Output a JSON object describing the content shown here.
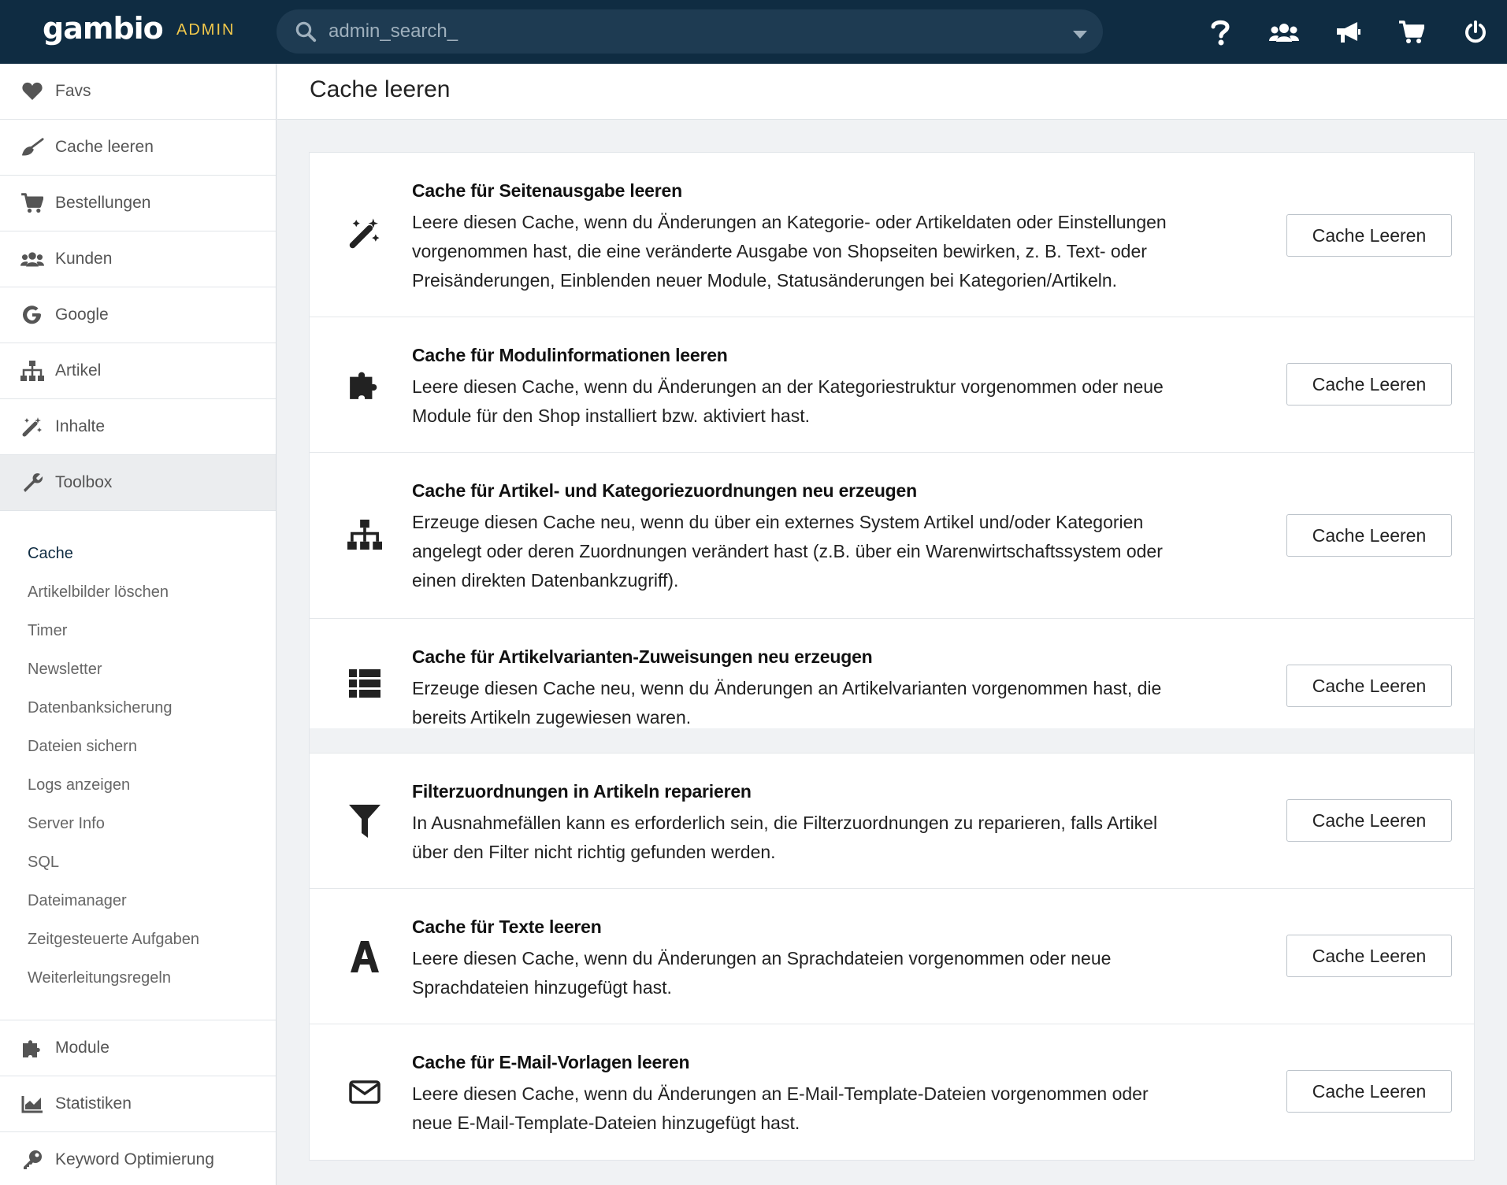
{
  "topbar": {
    "logo": "gambio",
    "admin_label": "ADMIN",
    "search_placeholder": "admin_search_",
    "icons": [
      "help-icon",
      "users-icon",
      "megaphone-icon",
      "cart-icon",
      "power-icon"
    ]
  },
  "sidebar": {
    "items": [
      {
        "label": "Favs",
        "icon": "heart-icon"
      },
      {
        "label": "Cache leeren",
        "icon": "broom-icon"
      },
      {
        "label": "Bestellungen",
        "icon": "cart-icon"
      },
      {
        "label": "Kunden",
        "icon": "users-icon"
      },
      {
        "label": "Google",
        "icon": "google-icon"
      },
      {
        "label": "Artikel",
        "icon": "sitemap-icon"
      },
      {
        "label": "Inhalte",
        "icon": "magic-wand-icon"
      },
      {
        "label": "Toolbox",
        "icon": "wrench-icon"
      }
    ],
    "toolbox_sub": [
      "Cache",
      "Artikelbilder löschen",
      "Timer",
      "Newsletter",
      "Datenbanksicherung",
      "Dateien sichern",
      "Logs anzeigen",
      "Server Info",
      "SQL",
      "Dateimanager",
      "Zeitgesteuerte Aufgaben",
      "Weiterleitungsregeln"
    ],
    "bottom_items": [
      {
        "label": "Module",
        "icon": "puzzle-icon"
      },
      {
        "label": "Statistiken",
        "icon": "chart-icon"
      },
      {
        "label": "Keyword Optimierung",
        "icon": "key-icon"
      }
    ]
  },
  "main": {
    "title": "Cache leeren",
    "cards": [
      {
        "icon": "magic-wand-icon",
        "title": "Cache für Seitenausgabe leeren",
        "lines": [
          "Leere diesen Cache, wenn du Änderungen an Kategorie- oder Artikeldaten oder Einstellungen",
          "vorgenommen hast, die eine veränderte Ausgabe von Shopseiten bewirken, z. B. Text- oder",
          "Preisänderungen, Einblenden neuer Module, Statusänderungen bei Kategorien/Artikeln."
        ],
        "button": "Cache Leeren"
      },
      {
        "icon": "puzzle-icon",
        "title": "Cache für Modulinformationen leeren",
        "lines": [
          "Leere diesen Cache, wenn du Änderungen an der Kategoriestruktur vorgenommen oder neue",
          "Module für den Shop installiert bzw. aktiviert hast."
        ],
        "button": "Cache Leeren"
      },
      {
        "icon": "sitemap-icon",
        "title": "Cache für Artikel- und Kategoriezuordnungen neu erzeugen",
        "lines": [
          "Erzeuge diesen Cache neu, wenn du über ein externes System Artikel und/oder Kategorien",
          "angelegt oder deren Zuordnungen verändert hast (z.B. über ein Warenwirtschaftssystem oder",
          "einen direkten Datenbankzugriff)."
        ],
        "button": "Cache Leeren"
      },
      {
        "icon": "list-icon",
        "title": "Cache für Artikelvarianten-Zuweisungen neu erzeugen",
        "lines": [
          "Erzeuge diesen Cache neu, wenn du Änderungen an Artikelvarianten vorgenommen hast, die",
          "bereits Artikeln zugewiesen waren."
        ],
        "button": "Cache Leeren"
      },
      {
        "icon": "filter-icon",
        "title": "Filterzuordnungen in Artikeln reparieren",
        "lines": [
          "In Ausnahmefällen kann es erforderlich sein, die Filterzuordnungen zu reparieren, falls Artikel",
          "über den Filter nicht richtig gefunden werden."
        ],
        "button": "Cache Leeren"
      },
      {
        "icon": "font-icon",
        "title": "Cache für Texte leeren",
        "lines": [
          "Leere diesen Cache, wenn du Änderungen an Sprachdateien vorgenommen oder neue",
          "Sprachdateien hinzugefügt hast."
        ],
        "button": "Cache Leeren"
      },
      {
        "icon": "envelope-icon",
        "title": "Cache für E-Mail-Vorlagen leeren",
        "lines": [
          "Leere diesen Cache, wenn du Änderungen an E-Mail-Template-Dateien vorgenommen oder",
          "neue E-Mail-Template-Dateien hinzugefügt hast."
        ],
        "button": "Cache Leeren"
      }
    ]
  },
  "colors": {
    "topbar": "#0f2c42",
    "admin": "#f2c94c",
    "sidebar_active": "#ebedef"
  }
}
